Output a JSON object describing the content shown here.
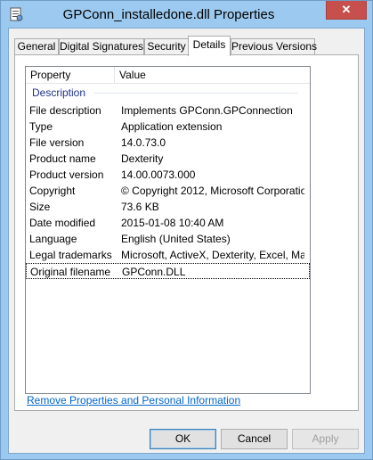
{
  "window": {
    "title": "GPConn_installedone.dll Properties",
    "close_glyph": "✕",
    "app_icon": "file-properties-icon"
  },
  "tabs": [
    {
      "label": "General"
    },
    {
      "label": "Digital Signatures"
    },
    {
      "label": "Security"
    },
    {
      "label": "Details",
      "active": true
    },
    {
      "label": "Previous Versions"
    }
  ],
  "list": {
    "columns": {
      "property": "Property",
      "value": "Value"
    },
    "group_label": "Description",
    "rows": [
      {
        "property": "File description",
        "value": "Implements GPConn.GPConnection"
      },
      {
        "property": "Type",
        "value": "Application extension"
      },
      {
        "property": "File version",
        "value": "14.0.73.0"
      },
      {
        "property": "Product name",
        "value": "Dexterity"
      },
      {
        "property": "Product version",
        "value": "14.00.0073.000"
      },
      {
        "property": "Copyright",
        "value": "© Copyright 2012, Microsoft Corporatio..."
      },
      {
        "property": "Size",
        "value": "73.6 KB"
      },
      {
        "property": "Date modified",
        "value": "2015-01-08 10:40 AM"
      },
      {
        "property": "Language",
        "value": "English (United States)"
      },
      {
        "property": "Legal trademarks",
        "value": "Microsoft, ActiveX, Dexterity, Excel, Ma..."
      },
      {
        "property": "Original filename",
        "value": "GPConn.DLL",
        "selected": true
      }
    ]
  },
  "remove_link": "Remove Properties and Personal Information",
  "buttons": {
    "ok": "OK",
    "cancel": "Cancel",
    "apply": "Apply"
  },
  "colors": {
    "frame": "#9cc9ef",
    "close_button": "#c7504c",
    "group_label": "#1e3287",
    "link": "#0066cc"
  }
}
